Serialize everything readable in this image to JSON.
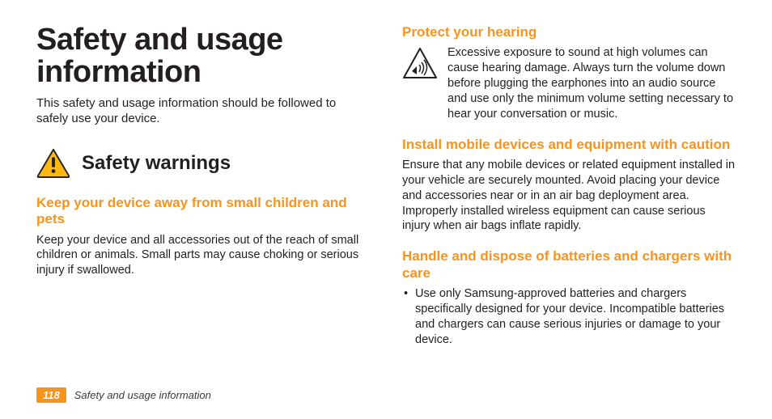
{
  "page": {
    "title": "Safety and usage information",
    "intro": "This safety and usage information should be followed to safely use your device."
  },
  "section": {
    "heading": "Safety warnings"
  },
  "left": {
    "h1_title": "Keep your device away from small children and pets",
    "h1_body": "Keep your device and all accessories out of the reach of small children or animals. Small parts may cause choking or serious injury if swallowed."
  },
  "right": {
    "h1_title": "Protect your hearing",
    "h1_body": "Excessive exposure to sound at high volumes can cause hearing damage. Always turn the volume down before plugging the earphones into an audio source and use only the minimum volume setting necessary to hear your conversation or music.",
    "h2_title": "Install mobile devices and equipment with caution",
    "h2_body": "Ensure that any mobile devices or related equipment installed in your vehicle are securely mounted. Avoid placing your device and accessories near or in an air bag deployment area. Improperly installed wireless equipment can cause serious injury when air bags inflate rapidly.",
    "h3_title": "Handle and dispose of batteries and chargers with care",
    "h3_bullet1": "Use only Samsung-approved batteries and chargers specifically designed for your device. Incompatible batteries and chargers can cause serious injuries or damage to your device."
  },
  "footer": {
    "page_number": "118",
    "section_name": "Safety and usage information"
  },
  "icons": {
    "warning": "warning-triangle-icon",
    "hearing": "hearing-warning-icon"
  }
}
